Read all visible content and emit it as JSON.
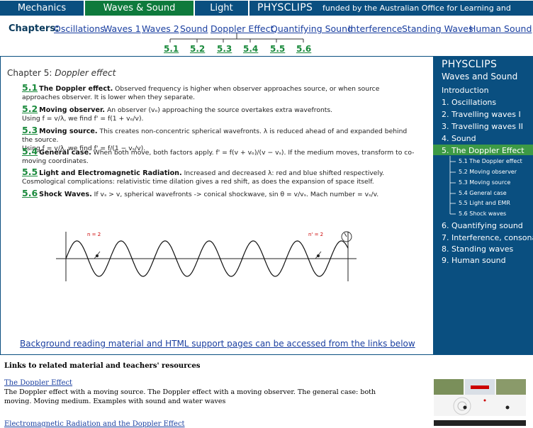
{
  "topnav": {
    "mechanics": "Mechanics",
    "waves": "Waves & Sound",
    "light": "Light",
    "brand": "PHYSCLIPS",
    "funded": "funded by the Australian Office for Learning and Teaching"
  },
  "chapters": {
    "label": "Chapters:",
    "links": [
      "Oscillations",
      "Waves 1",
      "Waves 2",
      "Sound",
      "Doppler Effect",
      "Quantifying Sound",
      "Interference",
      "Standing Waves",
      "Human Sound"
    ],
    "subs": [
      "5.1",
      "5.2",
      "5.3",
      "5.4",
      "5.5",
      "5.6"
    ]
  },
  "main": {
    "chapter_prefix": "Chapter 5:",
    "chapter_name": "Doppler effect",
    "entries": [
      {
        "num": "5.1",
        "head": "The Doppler effect.",
        "text": " Observed frequency is higher when observer approaches source, or when source approaches observer. It is lower when they separate.",
        "sub": ""
      },
      {
        "num": "5.2",
        "head": "Moving observer.",
        "text": " An observer (vₒ) approaching the source overtakes extra wavefronts.",
        "sub": "Using f = v/λ, we find f' = f(1 + vₒ/v)."
      },
      {
        "num": "5.3",
        "head": "Moving source.",
        "text": " This creates non-concentric spherical wavefronts. λ is reduced ahead of and expanded behind the source.",
        "sub": "Using f = v/λ, we find f' = f/(1 − vₛ/v)."
      },
      {
        "num": "5.4",
        "head": "General case.",
        "text": " When both move, both factors apply. f' = f(v + vₒ)/(v − vₛ). If the medium moves, transform to co-moving coordinates.",
        "sub": ""
      },
      {
        "num": "5.5",
        "head": "Light and Electromagnetic Radiation.",
        "text": " Increased and decreased λ: red and blue shifted respectively. Cosmological complications: relativistic time dilation gives a red shift, as does the expansion of space itself.",
        "sub": ""
      },
      {
        "num": "5.6",
        "head": "Shock Waves.",
        "text": " If vₛ > v, spherical wavefronts -> conical shockwave, sin θ = v/vₛ. Mach number = vₛ/v.",
        "sub": ""
      }
    ],
    "wave_label_left": "n = 2",
    "wave_label_right": "n' = 2",
    "bg_link": "Background reading material and HTML support pages can be accessed from the links below"
  },
  "sidebar": {
    "brand": "PHYSCLIPS",
    "sub": "Waves and Sound",
    "items": [
      "Introduction",
      "1. Oscillations",
      "2. Travelling waves I",
      "3. Travelling waves II",
      "4. Sound",
      "5. The Doppler Effect",
      "6. Quantifying sound",
      "7. Interference, consonance",
      "8. Standing waves",
      "9. Human sound"
    ],
    "subitems": [
      "5.1 The Doppler effect",
      "5.2 Moving observer",
      "5.3 Moving source",
      "5.4 General case",
      "5.5 Light and EMR",
      "5.6 Shock waves"
    ]
  },
  "bottom": {
    "title": "Links to related material and teachers' resources",
    "link1": "The Doppler Effect",
    "desc1": "The Doppler effect with a moving source. The Doppler effect with a moving observer. The general case: both moving. Moving medium. Examples with sound and water waves",
    "link2": "Electromagnetic Radiation and the Doppler Effect"
  },
  "colors": {
    "nav_blue": "#0a4f80",
    "nav_green": "#0e7a3c",
    "sub_green": "#1a8a3c",
    "link_blue": "#1a3fa0",
    "active_green": "#3d9a45"
  }
}
